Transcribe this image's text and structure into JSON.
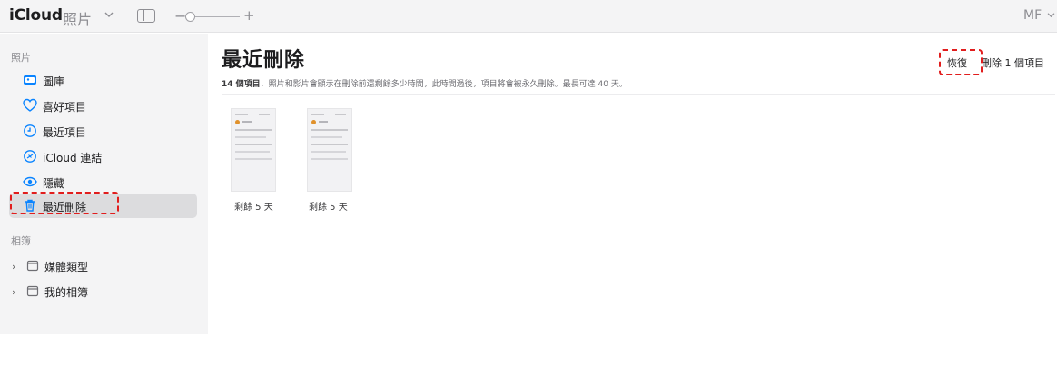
{
  "app": {
    "brand": "iCloud",
    "section": "照片",
    "account": "MF"
  },
  "toolbar": {
    "zoom_minus": "−",
    "zoom_plus": "+"
  },
  "sidebar": {
    "photos_header": "照片",
    "items": [
      {
        "label": "圖庫",
        "icon": "photo-library-icon"
      },
      {
        "label": "喜好項目",
        "icon": "heart-icon"
      },
      {
        "label": "最近項目",
        "icon": "clock-icon"
      },
      {
        "label": "iCloud 連結",
        "icon": "cloud-link-icon"
      },
      {
        "label": "隱藏",
        "icon": "eye-hidden-icon"
      },
      {
        "label": "最近刪除",
        "icon": "trash-icon",
        "selected": true
      }
    ],
    "albums_header": "相簿",
    "groups": [
      {
        "label": "媒體類型",
        "icon": "folder-icon"
      },
      {
        "label": "我的相簿",
        "icon": "folder-icon"
      }
    ]
  },
  "main": {
    "title": "最近刪除",
    "count": "14 個項目",
    "subtitle": "．照片和影片會顯示在刪除前還剩餘多少時間，此時間過後，項目將會被永久刪除。最長可達 40 天。",
    "restore_label": "恢復",
    "delete_label": "刪除 1 個項目",
    "thumbnails": [
      {
        "caption": "剩餘 5 天"
      },
      {
        "caption": "剩餘 5 天"
      }
    ]
  },
  "colors": {
    "accent": "#0a84ff",
    "highlight": "#e11d1d",
    "sidebar_bg": "#f4f4f5",
    "selected_bg": "#dcdcde"
  }
}
